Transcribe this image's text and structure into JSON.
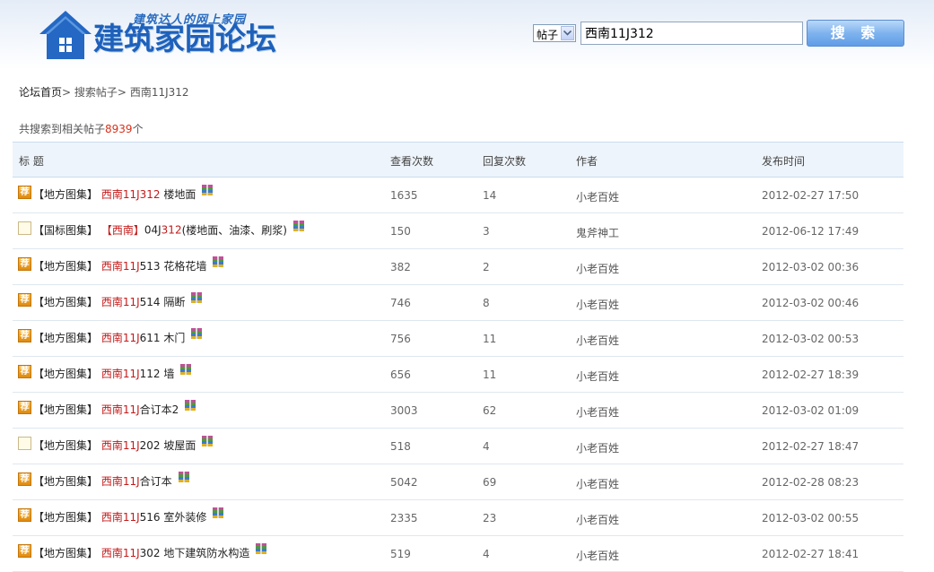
{
  "header": {
    "slogan": "建筑达人的网上家园",
    "site_title": "建筑家园论坛",
    "search_type": "帖子",
    "search_value": "西南11J312",
    "search_button": "搜 索"
  },
  "breadcrumb": {
    "home": "论坛首页",
    "sep1": ">",
    "search": "搜索帖子",
    "sep2": ">",
    "current": "西南11J312"
  },
  "results": {
    "prefix": "共搜索到相关帖子",
    "count": "8939",
    "suffix": "个"
  },
  "table": {
    "headers": {
      "title": "标 题",
      "views": "查看次数",
      "replies": "回复次数",
      "author": "作者",
      "time": "发布时间"
    },
    "rows": [
      {
        "badge": "荐",
        "category": "【地方图集】",
        "hl": "西南11J312",
        "rest": " 楼地面",
        "views": "1635",
        "replies": "14",
        "author": "小老百姓",
        "time": "2012-02-27 17:50"
      },
      {
        "badge": "",
        "category": "【国标图集】",
        "hl": "【西南】",
        "mid": "04J",
        "hl2": "312",
        "rest": "(楼地面、油漆、刷浆)",
        "views": "150",
        "replies": "3",
        "author": "鬼斧神工",
        "time": "2012-06-12 17:49"
      },
      {
        "badge": "荐",
        "category": "【地方图集】",
        "hl": "西南11J",
        "rest": "513 花格花墙",
        "views": "382",
        "replies": "2",
        "author": "小老百姓",
        "time": "2012-03-02 00:36"
      },
      {
        "badge": "荐",
        "category": "【地方图集】",
        "hl": "西南11J",
        "rest": "514 隔断",
        "views": "746",
        "replies": "8",
        "author": "小老百姓",
        "time": "2012-03-02 00:46"
      },
      {
        "badge": "荐",
        "category": "【地方图集】",
        "hl": "西南11J",
        "rest": "611 木门",
        "views": "756",
        "replies": "11",
        "author": "小老百姓",
        "time": "2012-03-02 00:53"
      },
      {
        "badge": "荐",
        "category": "【地方图集】",
        "hl": "西南11J",
        "rest": "112 墙",
        "views": "656",
        "replies": "11",
        "author": "小老百姓",
        "time": "2012-02-27 18:39"
      },
      {
        "badge": "荐",
        "category": "【地方图集】",
        "hl": "西南11J",
        "rest": "合订本2",
        "views": "3003",
        "replies": "62",
        "author": "小老百姓",
        "time": "2012-03-02 01:09"
      },
      {
        "badge": "",
        "category": "【地方图集】",
        "hl": "西南11J",
        "rest": "202 坡屋面",
        "views": "518",
        "replies": "4",
        "author": "小老百姓",
        "time": "2012-02-27 18:47"
      },
      {
        "badge": "荐",
        "category": "【地方图集】",
        "hl": "西南11J",
        "rest": "合订本",
        "views": "5042",
        "replies": "69",
        "author": "小老百姓",
        "time": "2012-02-28 08:23"
      },
      {
        "badge": "荐",
        "category": "【地方图集】",
        "hl": "西南11J",
        "rest": "516 室外装修",
        "views": "2335",
        "replies": "23",
        "author": "小老百姓",
        "time": "2012-03-02 00:55"
      },
      {
        "badge": "荐",
        "category": "【地方图集】",
        "hl": "西南11J",
        "rest": "302 地下建筑防水构造",
        "views": "519",
        "replies": "4",
        "author": "小老百姓",
        "time": "2012-02-27 18:41"
      }
    ]
  }
}
